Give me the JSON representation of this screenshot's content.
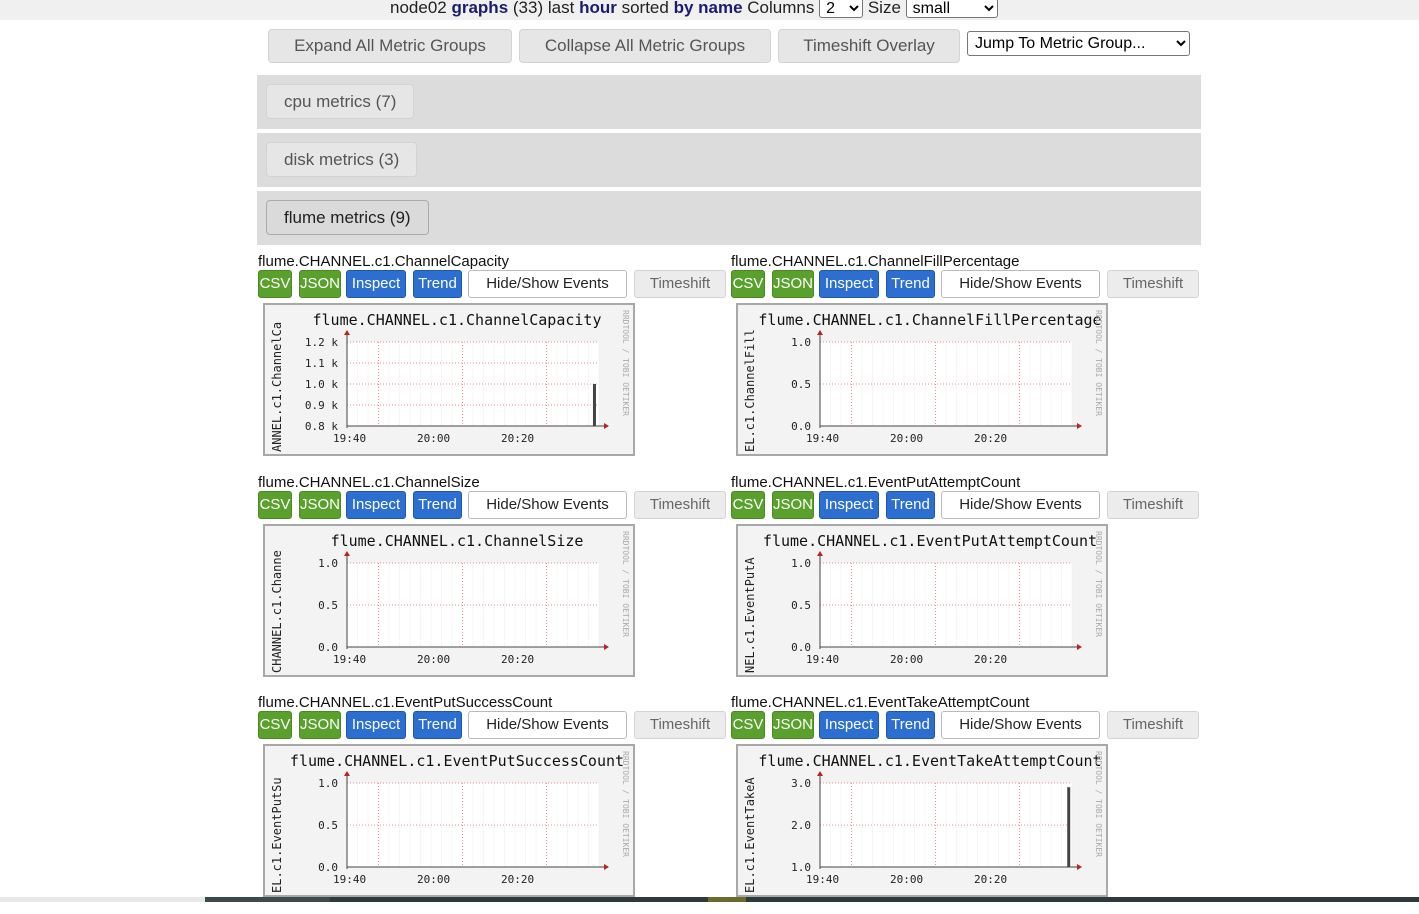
{
  "header": {
    "host": "node02",
    "graphs_word": "graphs",
    "count": "(33)",
    "last_word": "last",
    "period": "hour",
    "sorted_word": "sorted",
    "sort_by": "by name",
    "columns_label": "Columns",
    "columns_value": "2",
    "size_label": "Size",
    "size_value": "small"
  },
  "toolbar": {
    "expand_label": "Expand All Metric Groups",
    "collapse_label": "Collapse All Metric Groups",
    "timeshift_overlay_label": "Timeshift Overlay",
    "jump_label": "Jump To Metric Group..."
  },
  "groups": [
    {
      "label": "cpu metrics (7)"
    },
    {
      "label": "disk metrics (3)"
    },
    {
      "label": "flume metrics (9)"
    }
  ],
  "graph_buttons": {
    "csv": "CSV",
    "json": "JSON",
    "inspect": "Inspect",
    "trend": "Trend",
    "events": "Hide/Show Events",
    "timeshift": "Timeshift"
  },
  "watermark": "RRDTOOL / TOBI OETIKER",
  "graphs": [
    {
      "title": "flume.CHANNEL.c1.ChannelCapacity",
      "inner_title": "flume.CHANNEL.c1.ChannelCapacity",
      "side_label": "ANNEL.c1.ChannelCa",
      "y_ticks": [
        "1.2 k",
        "1.1 k",
        "1.0 k",
        "0.9 k",
        "0.8 k"
      ],
      "x_ticks": [
        "19:40",
        "20:00",
        "20:20"
      ],
      "spike": {
        "x_frac": 0.98,
        "top_frac": 0.5
      }
    },
    {
      "title": "flume.CHANNEL.c1.ChannelFillPercentage",
      "inner_title": "flume.CHANNEL.c1.ChannelFillPercentage",
      "side_label": "EL.c1.ChannelFill",
      "y_ticks": [
        "1.0",
        "0.5",
        "0.0"
      ],
      "x_ticks": [
        "19:40",
        "20:00",
        "20:20"
      ],
      "spike": null
    },
    {
      "title": "flume.CHANNEL.c1.ChannelSize",
      "inner_title": "flume.CHANNEL.c1.ChannelSize",
      "side_label": "CHANNEL.c1.Channe",
      "y_ticks": [
        "1.0",
        "0.5",
        "0.0"
      ],
      "x_ticks": [
        "19:40",
        "20:00",
        "20:20"
      ],
      "spike": null
    },
    {
      "title": "flume.CHANNEL.c1.EventPutAttemptCount",
      "inner_title": "flume.CHANNEL.c1.EventPutAttemptCount",
      "side_label": "NEL.c1.EventPutA",
      "y_ticks": [
        "1.0",
        "0.5",
        "0.0"
      ],
      "x_ticks": [
        "19:40",
        "20:00",
        "20:20"
      ],
      "spike": null
    },
    {
      "title": "flume.CHANNEL.c1.EventPutSuccessCount",
      "inner_title": "flume.CHANNEL.c1.EventPutSuccessCount",
      "side_label": "EL.c1.EventPutSu",
      "y_ticks": [
        "1.0",
        "0.5",
        "0.0"
      ],
      "x_ticks": [
        "19:40",
        "20:00",
        "20:20"
      ],
      "spike": null
    },
    {
      "title": "flume.CHANNEL.c1.EventTakeAttemptCount",
      "inner_title": "flume.CHANNEL.c1.EventTakeAttemptCount",
      "side_label": "EL.c1.EventTakeA",
      "y_ticks": [
        "3.0",
        "2.0",
        "1.0"
      ],
      "x_ticks": [
        "19:40",
        "20:00",
        "20:20"
      ],
      "spike": {
        "x_frac": 0.985,
        "top_frac": 0.05
      }
    }
  ]
}
